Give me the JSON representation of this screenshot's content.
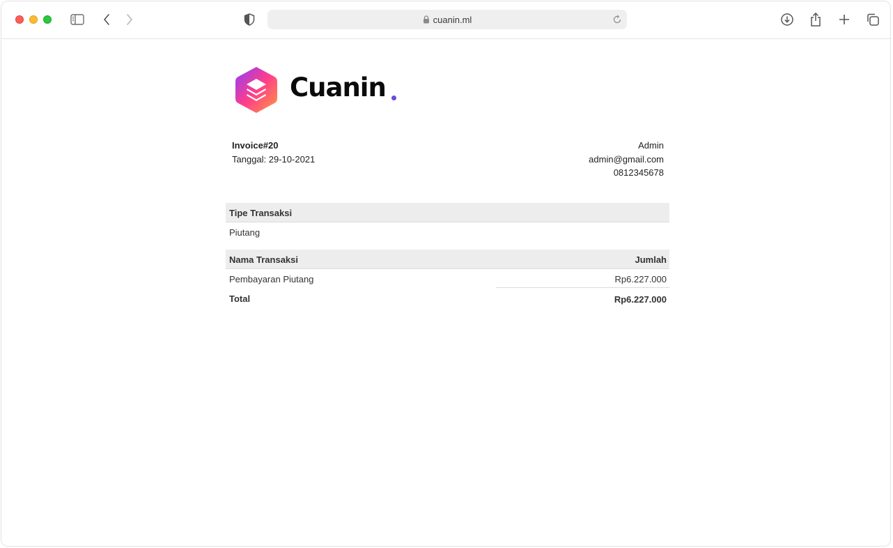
{
  "browser": {
    "url": "cuanin.ml",
    "icons": {
      "sidebar": "sidebar-icon",
      "back": "chevron-left-icon",
      "forward": "chevron-right-icon",
      "privacy": "shield-icon",
      "lock": "lock-icon",
      "reload": "reload-icon",
      "download": "download-icon",
      "share": "share-icon",
      "new_tab": "plus-icon",
      "tabs": "tabs-overview-icon"
    }
  },
  "brand": {
    "name": "Cuanin",
    "dot_color": "#6c4bd8",
    "logo_gradient": [
      "#8b3dff",
      "#ff3d8b",
      "#ff9a3d"
    ]
  },
  "invoice": {
    "number": "Invoice#20",
    "date": "Tanggal: 29-10-2021",
    "customer": {
      "name": "Admin",
      "email": "admin@gmail.com",
      "phone": "0812345678"
    },
    "type_header": "Tipe Transaksi",
    "type_value": "Piutang",
    "items_header": {
      "name": "Nama Transaksi",
      "amount": "Jumlah"
    },
    "items": [
      {
        "name": "Pembayaran Piutang",
        "amount": "Rp6.227.000"
      }
    ],
    "total_label": "Total",
    "total_value": "Rp6.227.000"
  }
}
